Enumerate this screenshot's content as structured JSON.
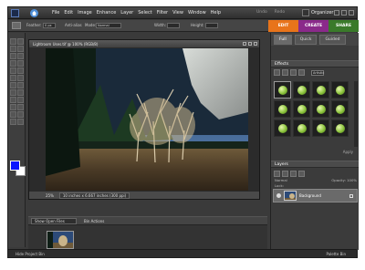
{
  "menu": {
    "items": [
      "File",
      "Edit",
      "Image",
      "Enhance",
      "Layer",
      "Select",
      "Filter",
      "View",
      "Window",
      "Help"
    ],
    "undo_label": "Undo",
    "redo_label": "Redo",
    "organizer_label": "Organizer"
  },
  "options": {
    "feather_label": "Feather:",
    "feather_value": "0 px",
    "antialias_label": "Anti-alias",
    "mode_label": "Mode:",
    "mode_value": "Normal",
    "width_label": "Width:",
    "height_label": "Height:"
  },
  "mode_tabs": {
    "edit": "EDIT",
    "create": "CREATE",
    "share": "SHARE"
  },
  "document": {
    "title": "Lightroom Uses.tif @ 100% (RGB/8)",
    "zoom": "25%",
    "info": "10 inches x 6.667 inches (300 ppi)"
  },
  "project_bin": {
    "select_value": "Show Open Files",
    "actions_label": "Bin Actions"
  },
  "bottom": {
    "hide_bin": "Hide Project Bin",
    "palette_bin": "Palette Bin"
  },
  "palette": {
    "tabs": [
      "Full",
      "Quick",
      "Guided"
    ],
    "effects_title": "Effects",
    "fx_select_value": "Artistic",
    "apply_label": "Apply",
    "layers_title": "Layers",
    "blend_mode": "Normal",
    "opacity_label": "Opacity:",
    "opacity_value": "100%",
    "lock_label": "Lock:",
    "layer_name": "Background"
  },
  "colors": {
    "foreground": "#0a14ff",
    "background": "#ffffff",
    "edit_tab": "#e8741a",
    "create_tab": "#8a2a8a",
    "share_tab": "#3a7a2a"
  }
}
